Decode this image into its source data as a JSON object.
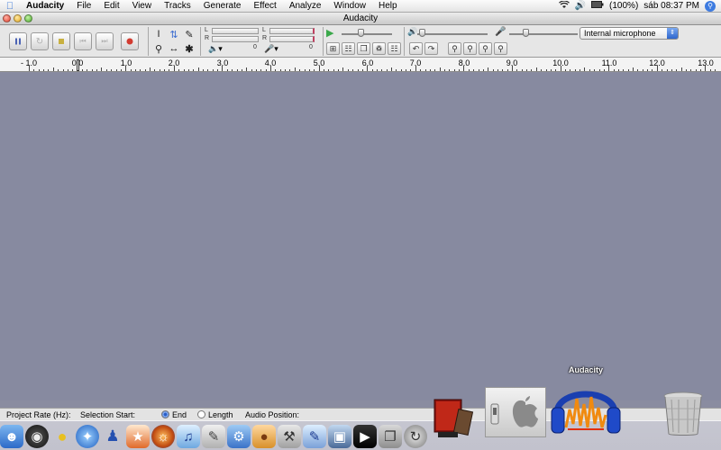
{
  "menubar": {
    "app_name": "Audacity",
    "menus": [
      "File",
      "Edit",
      "View",
      "Tracks",
      "Generate",
      "Effect",
      "Analyze",
      "Window",
      "Help"
    ],
    "battery": "(100%)",
    "clock": "sáb 08:37 PM"
  },
  "window": {
    "title": "Audacity"
  },
  "toolbar": {
    "meter_left_label": "L",
    "meter_right_label": "R",
    "meter_zero": "0",
    "input_source": "Internal microphone"
  },
  "ruler": {
    "labels": [
      "- 1.0",
      "0.0",
      "1.0",
      "2.0",
      "3.0",
      "4.0",
      "5.0",
      "6.0",
      "7.0",
      "8.0",
      "9.0",
      "10.0",
      "11.0",
      "12.0",
      "13.0"
    ]
  },
  "selection_bar": {
    "project_rate_label": "Project Rate (Hz):",
    "selection_start_label": "Selection Start:",
    "end_label": "End",
    "length_label": "Length",
    "audio_position_label": "Audio Position:"
  },
  "dock": {
    "hover_label": "Audacity"
  },
  "colors": {
    "track_area": "#878aa0",
    "accent_blue": "#3d7be0"
  }
}
